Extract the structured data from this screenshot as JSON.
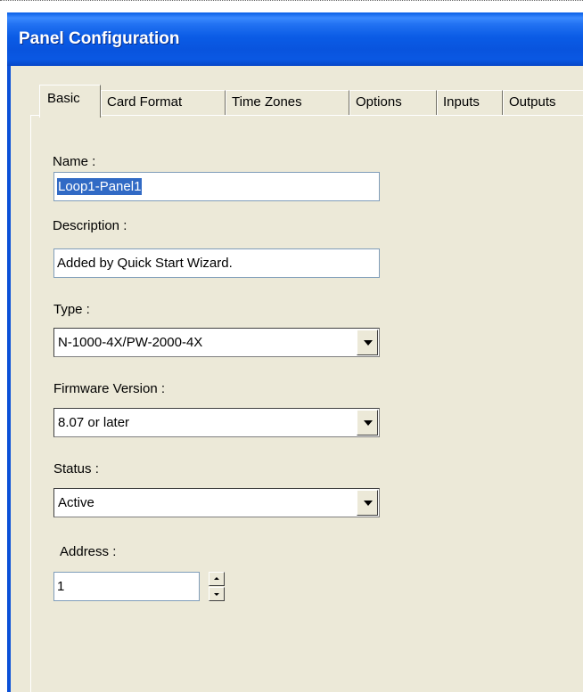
{
  "window": {
    "title": "Panel Configuration"
  },
  "tabs": [
    {
      "label": "Basic",
      "active": true
    },
    {
      "label": "Card Format",
      "active": false
    },
    {
      "label": "Time Zones",
      "active": false
    },
    {
      "label": "Options",
      "active": false
    },
    {
      "label": "Inputs",
      "active": false
    },
    {
      "label": "Outputs",
      "active": false
    }
  ],
  "form": {
    "name": {
      "label": "Name :",
      "value": "Loop1-Panel1"
    },
    "description": {
      "label": "Description :",
      "value": "Added by Quick Start Wizard."
    },
    "type": {
      "label": "Type :",
      "value": "N-1000-4X/PW-2000-4X"
    },
    "firmware": {
      "label": "Firmware Version :",
      "value": "8.07 or later"
    },
    "status": {
      "label": "Status :",
      "value": "Active"
    },
    "address": {
      "label": "Address :",
      "value": "1"
    }
  },
  "colors": {
    "titlebar": "#0a5fe6",
    "client_bg": "#ece9d8",
    "selection": "#316ac5"
  }
}
